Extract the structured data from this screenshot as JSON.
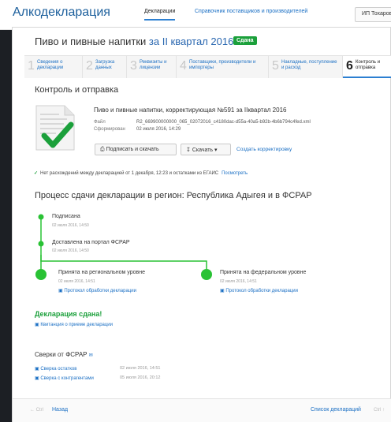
{
  "topbar": {
    "brand": "Алкодекларация",
    "nav": [
      "Декларации",
      "Справочник поставщиков и производителей"
    ],
    "user": "ИП Тохаров"
  },
  "header": {
    "title": "Пиво и пивные напитки",
    "quarter": "за II квартал 2016",
    "status": "Сдана"
  },
  "steps": [
    {
      "num": "1",
      "label": "Сведения о декларации"
    },
    {
      "num": "2",
      "label": "Загрузка данных"
    },
    {
      "num": "3",
      "label": "Реквизиты и лицензии"
    },
    {
      "num": "4",
      "label": "Поставщики, производители и импортеры"
    },
    {
      "num": "5",
      "label": "Накладные, поступление и расход"
    },
    {
      "num": "6",
      "label": "Контроль и отправка"
    }
  ],
  "section": {
    "title": "Контроль и отправка"
  },
  "file": {
    "title": "Пиво и пивные напитки, корректирующая №591 за IIквартал 2016",
    "file_label": "Файл",
    "file_name": "R2_669900000000_065_02072016_c4180dac-d55a-40a5-b92b-4b6b794c4fed.xml",
    "formed_label": "Сформирован",
    "formed_value": "02 июля 2016, 14:29"
  },
  "actions": {
    "sign": "Подписать и скачать",
    "download": "Скачать",
    "create": "Создать корректировку"
  },
  "check": {
    "text": "Нет расхождений  между декларацией от 1 декабря, 12:23 и остатками из ЕГАИС",
    "link": "Посмотреть"
  },
  "process": {
    "title": "Процесс сдачи декларации в регион: Республика Адыгея и в ФСРАР",
    "stages": [
      {
        "title": "Подписана",
        "date": "02 июля 2016, 14:50"
      },
      {
        "title": "Доставлена на портал ФСРАР",
        "date": "02 июля 2016, 14:50"
      },
      {
        "title": "Принята на региональном уровне",
        "date": "02 июля 2016, 14:51",
        "link": "Протокол обработки декларации"
      },
      {
        "title": "Принята на федеральном уровне",
        "date": "02 июля 2016, 14:51",
        "link": "Протокол обработки декларации"
      }
    ],
    "accent": "#29c234"
  },
  "done": {
    "title": "Декларация сдана!",
    "receipt": "Квитанция о приеме декларации"
  },
  "fsrar": {
    "title": "Сверки от ФСРАР",
    "items": [
      {
        "label": "Сверка остатков",
        "date": "02 июля 2016, 14:51"
      },
      {
        "label": "Сверка с контрагентами",
        "date": "05 июля 2016, 20:12"
      }
    ]
  },
  "footer": {
    "prev_hint": "← Ctrl",
    "back": "Назад",
    "list": "Список деклараций",
    "next_hint": "Ctrl ↑"
  }
}
